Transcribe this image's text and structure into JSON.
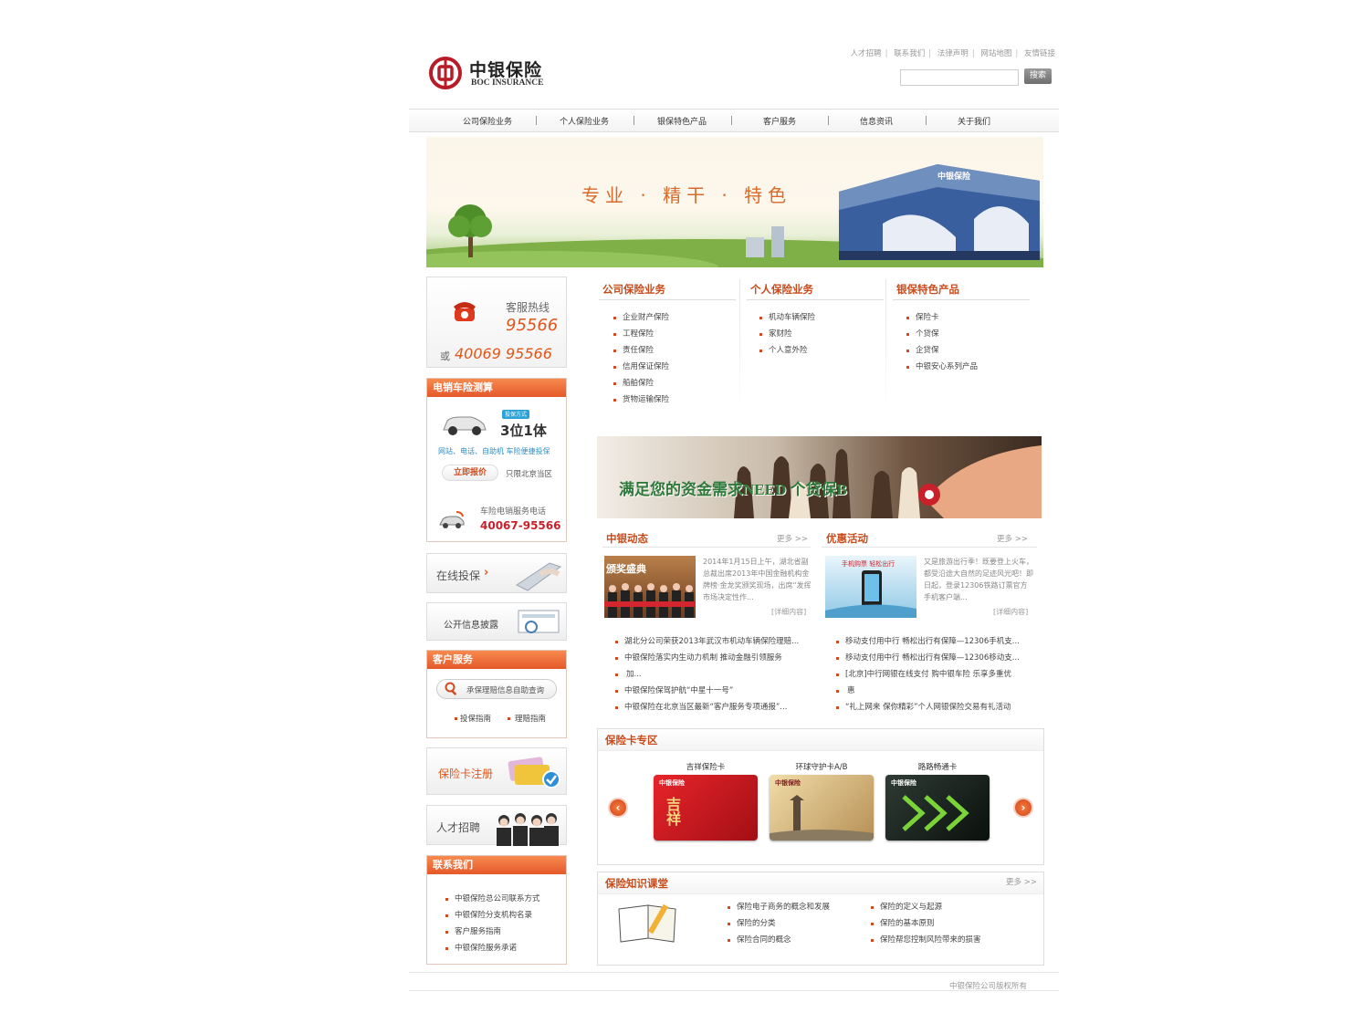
{
  "header": {
    "logo_cn": "中银保险",
    "logo_en": "BOC INSURANCE",
    "top_links": [
      "人才招聘",
      "联系我们",
      "法律声明",
      "网站地图",
      "友情链接"
    ],
    "search_button": "搜索",
    "search_value": ""
  },
  "nav": [
    "公司保险业务",
    "个人保险业务",
    "银保特色产品",
    "客户服务",
    "信息资讯",
    "关于我们"
  ],
  "banner": {
    "slogan": "专业 · 精干 · 特色",
    "building_sign": "中银保险"
  },
  "left": {
    "hotline_label": "客服热线",
    "hotline_number": "95566",
    "hotline_or": "或",
    "hotline_alt": "40069 95566",
    "car_title": "电销车险测算",
    "car_badge_top": "投保方式",
    "car_badge": "3位1体",
    "car_channels": "网站、电话、自助机  车险便捷投保",
    "car_quote_btn": "立即报价",
    "car_area": "只限北京当区",
    "car_phone_label": "车险电销服务电话",
    "car_phone": "40067-95566",
    "online_label": "在线投保",
    "disclosure_label": "公开信息披露",
    "service_title": "客户服务",
    "service_query": "承保理赔信息自助查询",
    "service_links": [
      "投保指南",
      "理赔指南"
    ],
    "card_reg": "保险卡注册",
    "jobs": "人才招聘",
    "contact_title": "联系我们",
    "contact_items": [
      "中银保险总公司联系方式",
      "中银保险分支机构名录",
      "客户服务指南",
      "中银保险服务承诺"
    ]
  },
  "biz": {
    "corp_title": "公司保险业务",
    "corp_items": [
      "企业财产保险",
      "工程保险",
      "责任保险",
      "信用保证保险",
      "船舶保险",
      "货物运输保险"
    ],
    "personal_title": "个人保险业务",
    "personal_items": [
      "机动车辆保险",
      "家财险",
      "个人意外险"
    ],
    "banc_title": "银保特色产品",
    "banc_items": [
      "保险卡",
      "个贷保",
      "企贷保",
      "中银安心系列产品"
    ]
  },
  "promo": {
    "text": "满足您的资金需求NEED 个贷保B"
  },
  "news": {
    "title": "中银动态",
    "more": "更多 >>",
    "img_caption": "颁奖盛典",
    "summary": "2014年1月15日上午，湖北省副总裁出席2013年中国金融机构金牌榜·金龙奖颁奖现场，出席“发挥市场决定性作...",
    "detail": "[详细内容]",
    "items": [
      "湖北分公司荣获2013年武汉市机动车辆保险理赔...",
      "中银保险落实内生动力机制 推动金融引领服务",
      "加...",
      "中银保险保驾护航“中星十一号”",
      "中银保险在北京当区最新“客户服务专项通报”..."
    ]
  },
  "offers": {
    "title": "优惠活动",
    "more": "更多 >>",
    "img_caption": "手机购票 轻松出行",
    "summary": "又是旅游出行季！既要登上火车，都受沿途大自然的足迹风光吧！即日起，登录12306铁路订票官方手机客户端...",
    "detail": "[详细内容]",
    "items": [
      "移动支付用中行  畅松出行有保障—12306手机支...",
      "移动支付用中行  畅松出行有保障—12306移动支...",
      "[北京]中行网银在线支付  购中银车险  乐享多重优",
      "惠",
      "“礼上网来  保你精彩”个人网银保险交易有礼活动"
    ]
  },
  "cards": {
    "title": "保险卡专区",
    "items": [
      {
        "name": "吉祥保险卡",
        "color": "#c8151b"
      },
      {
        "name": "环球守护卡A/B",
        "color": "#d9b56a"
      },
      {
        "name": "路路畅通卡",
        "color": "#1b2a20"
      }
    ],
    "card_brand": "中银保险"
  },
  "knowledge": {
    "title": "保险知识课堂",
    "more": "更多 >>",
    "col1": [
      "保险电子商务的概念和发展",
      "保险的分类",
      "保险合同的概念"
    ],
    "col2": [
      "保险的定义与起源",
      "保险的基本原则",
      "保险帮您控制风险带来的损害"
    ]
  },
  "footer": {
    "copyright": "中银保险公司版权所有"
  },
  "colors": {
    "accent": "#d24a1d",
    "header_orange": "#e5582a",
    "brand_red": "#b71c28"
  }
}
